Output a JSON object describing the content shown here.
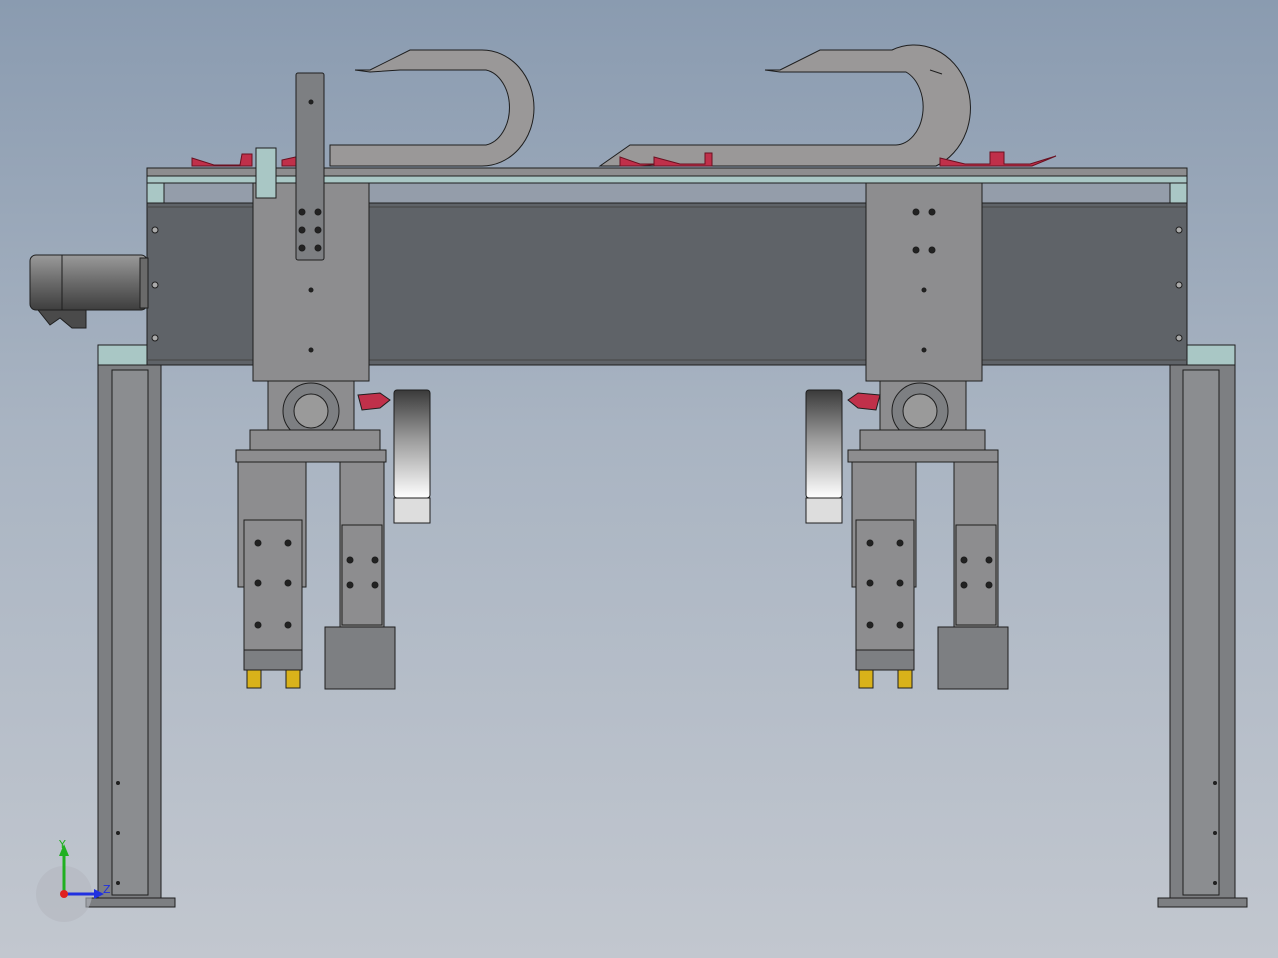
{
  "viewport": {
    "background_top": "#8a9bb0",
    "background_bottom": "#c2c7cf"
  },
  "colors": {
    "beam_dark": "#5f6368",
    "plate_gray": "#8d8d8f",
    "frame_gray": "#7d7f82",
    "cap_teal": "#a9c7c5",
    "cable_chain": "#9a9898",
    "red_clamp": "#c0304a",
    "fitting_yellow": "#d9b21a",
    "outline": "#1e1e1e",
    "axis_x": "#e02020",
    "axis_y": "#20b020",
    "axis_z": "#2030e0"
  },
  "triad": {
    "y_label": "Y",
    "z_label": "Z"
  }
}
